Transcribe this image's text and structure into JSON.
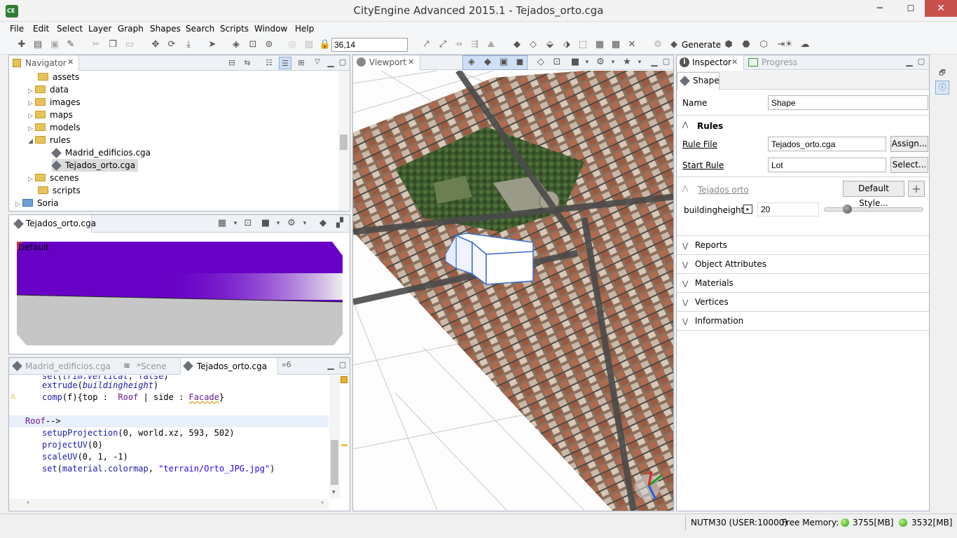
{
  "window": {
    "title": "CityEngine Advanced 2015.1 - Tejados_orto.cga",
    "minimize": "─",
    "maximize": "☐",
    "close": "✕"
  },
  "menu": [
    "File",
    "Edit",
    "Select",
    "Layer",
    "Graph",
    "Shapes",
    "Search",
    "Scripts",
    "Window",
    "Help"
  ],
  "toolbar": {
    "coord_value": "36,14",
    "generate_label": "Generate"
  },
  "navigator": {
    "tab_label": "Navigator",
    "items": [
      {
        "label": "assets",
        "type": "folder",
        "depth": 1,
        "expanded": null
      },
      {
        "label": "data",
        "type": "folder",
        "depth": 1,
        "expanded": false
      },
      {
        "label": "images",
        "type": "folder",
        "depth": 1,
        "expanded": false
      },
      {
        "label": "maps",
        "type": "folder",
        "depth": 1,
        "expanded": false
      },
      {
        "label": "models",
        "type": "folder",
        "depth": 1,
        "expanded": false
      },
      {
        "label": "rules",
        "type": "folder",
        "depth": 1,
        "expanded": true
      },
      {
        "label": "Madrid_edificios.cga",
        "type": "rule",
        "depth": 2,
        "expanded": null
      },
      {
        "label": "Tejados_orto.cga",
        "type": "rule",
        "depth": 2,
        "expanded": null,
        "selected": true
      },
      {
        "label": "scenes",
        "type": "folder",
        "depth": 1,
        "expanded": false
      },
      {
        "label": "scripts",
        "type": "folder",
        "depth": 1,
        "expanded": null
      },
      {
        "label": "Soria",
        "type": "project",
        "depth": 0,
        "expanded": false
      }
    ]
  },
  "preview": {
    "tab_label": "Tejados_orto.cga",
    "style_label": "Default"
  },
  "editor": {
    "tabs": [
      {
        "label": "Madrid_edificios.cga",
        "active": false
      },
      {
        "label": "*Scene",
        "active": false
      },
      {
        "label": "Tejados_orto.cga",
        "active": true
      },
      {
        "label": "»6",
        "active": false
      }
    ]
  },
  "viewport": {
    "tab_label": "Viewport"
  },
  "inspector": {
    "tab_label": "Inspector",
    "progress_tab_label": "Progress",
    "subtab_label": "Shape",
    "name_label": "Name",
    "name_value": "Shape",
    "rules_header": "Rules",
    "rule_file_label": "Rule File",
    "rule_file_value": "Tejados_orto.cga",
    "assign_button": "Assign...",
    "start_rule_label": "Start Rule",
    "start_rule_value": "Lot",
    "select_button": "Select...",
    "group_label": "Tejados orto",
    "default_style_button": "Default Style...",
    "add_button": "+",
    "param_label": "buildingheight",
    "param_value": "20",
    "slider_fraction": 0.23,
    "sections": [
      "Reports",
      "Object Attributes",
      "Materials",
      "Vertices",
      "Information"
    ]
  },
  "status": {
    "crs": "NUTM30 (USER:10000)",
    "memory_label": "Free Memory:",
    "mem1": "3755[MB]",
    "mem2": "3532[MB]"
  }
}
